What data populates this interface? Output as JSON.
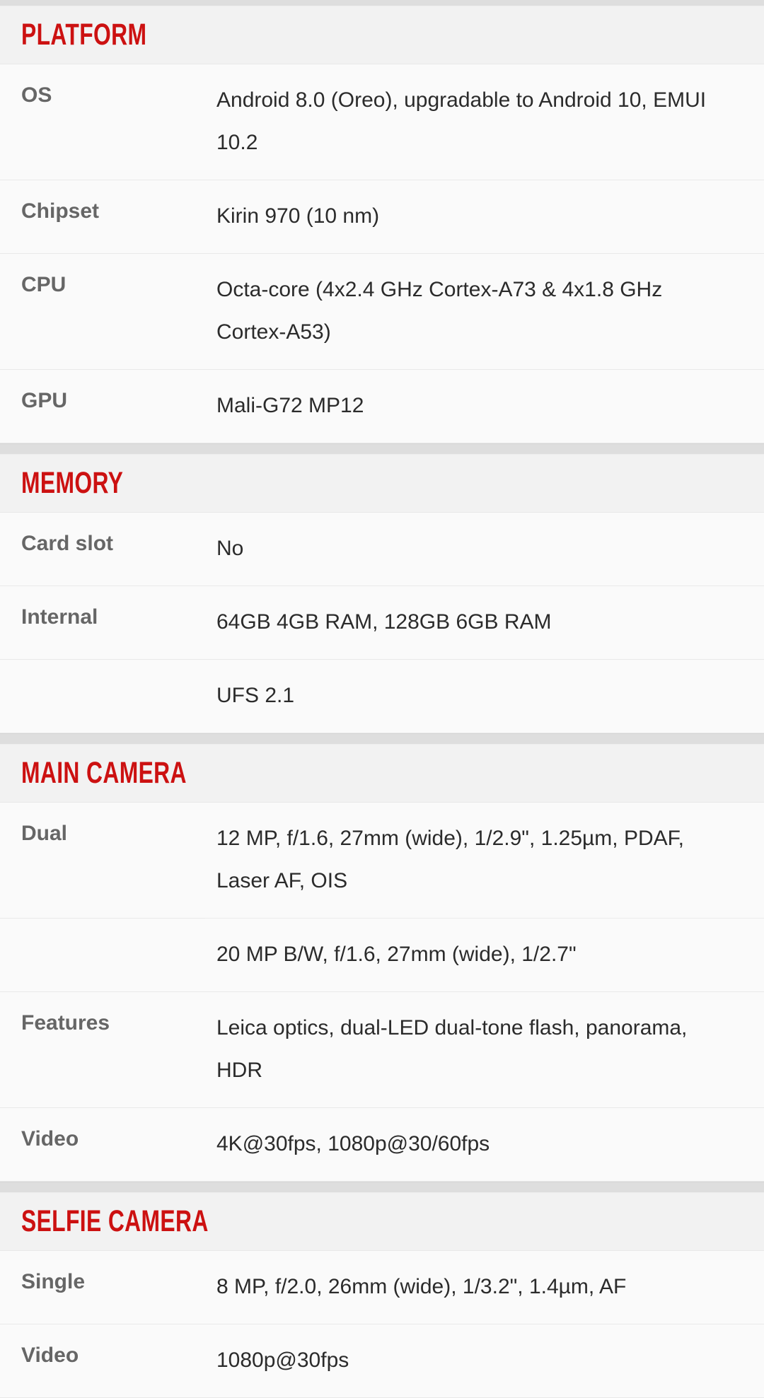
{
  "theme": {
    "accent_red": "#cc1111",
    "label_gray": "#666666",
    "value_dark": "#2b2b2b",
    "row_bg": "#fafafa",
    "header_bg": "#f2f2f2",
    "band_gray": "#dedede",
    "divider": "#e9e9e9"
  },
  "sections": [
    {
      "title": "PLATFORM",
      "rows": [
        {
          "label": "OS",
          "value": "Android 8.0 (Oreo), upgradable to Android 10, EMUI 10.2",
          "type": "main"
        },
        {
          "label": "Chipset",
          "value": "Kirin 970 (10 nm)",
          "type": "main"
        },
        {
          "label": "CPU",
          "value": "Octa-core (4x2.4 GHz Cortex-A73 & 4x1.8 GHz Cortex-A53)",
          "type": "main"
        },
        {
          "label": "GPU",
          "value": "Mali-G72 MP12",
          "type": "main"
        }
      ]
    },
    {
      "title": "MEMORY",
      "rows": [
        {
          "label": "Card slot",
          "value": "No",
          "type": "main"
        },
        {
          "label": "Internal",
          "value": "64GB 4GB RAM, 128GB 6GB RAM",
          "type": "main"
        },
        {
          "label": "",
          "value": "UFS 2.1",
          "type": "continuation-full"
        }
      ]
    },
    {
      "title": "MAIN CAMERA",
      "rows": [
        {
          "label": "Dual",
          "value": "12 MP, f/1.6, 27mm (wide), 1/2.9\", 1.25µm, PDAF, Laser AF, OIS",
          "type": "main"
        },
        {
          "label": "",
          "value": "20 MP B/W, f/1.6, 27mm (wide), 1/2.7\"",
          "type": "continuation-indented"
        },
        {
          "label": "Features",
          "value": "Leica optics, dual-LED dual-tone flash, panorama, HDR",
          "type": "main"
        },
        {
          "label": "Video",
          "value": "4K@30fps, 1080p@30/60fps",
          "type": "main"
        }
      ]
    },
    {
      "title": "SELFIE CAMERA",
      "rows": [
        {
          "label": "Single",
          "value": "8 MP, f/2.0, 26mm (wide), 1/3.2\", 1.4µm, AF",
          "type": "main"
        },
        {
          "label": "Video",
          "value": "1080p@30fps",
          "type": "main"
        }
      ]
    }
  ]
}
